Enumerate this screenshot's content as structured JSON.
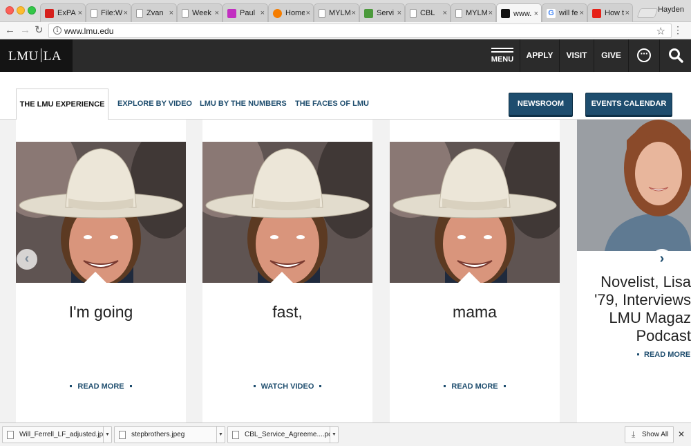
{
  "browser": {
    "profile": "Hayden",
    "tabs": [
      {
        "title": "ExPA",
        "icon": "adobe-icon",
        "color": "#d6201c"
      },
      {
        "title": "File:W",
        "icon": "document-icon",
        "color": "#9a9a9a"
      },
      {
        "title": "Zvan",
        "icon": "document-icon",
        "color": "#9a9a9a"
      },
      {
        "title": "Week",
        "icon": "document-icon",
        "color": "#9a9a9a"
      },
      {
        "title": "Paul",
        "icon": "bootstrap-icon",
        "color": "#c22fc1"
      },
      {
        "title": "Home",
        "icon": "blogger-icon",
        "color": "#f57d00"
      },
      {
        "title": "MYLM",
        "icon": "document-icon",
        "color": "#9a9a9a"
      },
      {
        "title": "Servi",
        "icon": "image-icon",
        "color": "#4c9a3c"
      },
      {
        "title": "CBL",
        "icon": "document-icon",
        "color": "#9a9a9a"
      },
      {
        "title": "MYLM",
        "icon": "document-icon",
        "color": "#9a9a9a"
      },
      {
        "title": "www.",
        "icon": "lmu-icon",
        "color": "#111111",
        "active": true
      },
      {
        "title": "will fe",
        "icon": "google-icon",
        "color": "#4285f4"
      },
      {
        "title": "How t",
        "icon": "youtube-icon",
        "color": "#e62117"
      }
    ],
    "url": "www.lmu.edu",
    "tab_close_glyph": "×"
  },
  "site": {
    "logo_left": "LMU",
    "logo_right": "LA",
    "menu_label": "MENU",
    "links": [
      "APPLY",
      "VISIT",
      "GIVE"
    ],
    "icons": [
      "more-icon",
      "search-icon"
    ]
  },
  "subnav": {
    "tabs": [
      "THE LMU EXPERIENCE",
      "EXPLORE BY VIDEO",
      "LMU BY THE NUMBERS",
      "THE FACES OF LMU"
    ],
    "buttons": {
      "newsroom": "NEWSROOM",
      "events": "EVENTS CALENDAR"
    }
  },
  "carousel": {
    "cards": [
      {
        "title": "I'm going",
        "link": "READ MORE"
      },
      {
        "title": "fast,",
        "link": "WATCH VIDEO"
      },
      {
        "title": "mama",
        "link": "READ MORE"
      }
    ],
    "partial_card": {
      "title_lines": [
        "Novelist, Lisa",
        "'79, Interviews",
        "LMU Magaz",
        "Podcast"
      ],
      "link": "READ MORE"
    },
    "accent": "#1e4d6e"
  },
  "downloads": {
    "items": [
      "Will_Ferrell_LF_adjusted.jpg",
      "stepbrothers.jpeg",
      "CBL_Service_Agreeme....pdf"
    ],
    "show_all": "Show All"
  }
}
